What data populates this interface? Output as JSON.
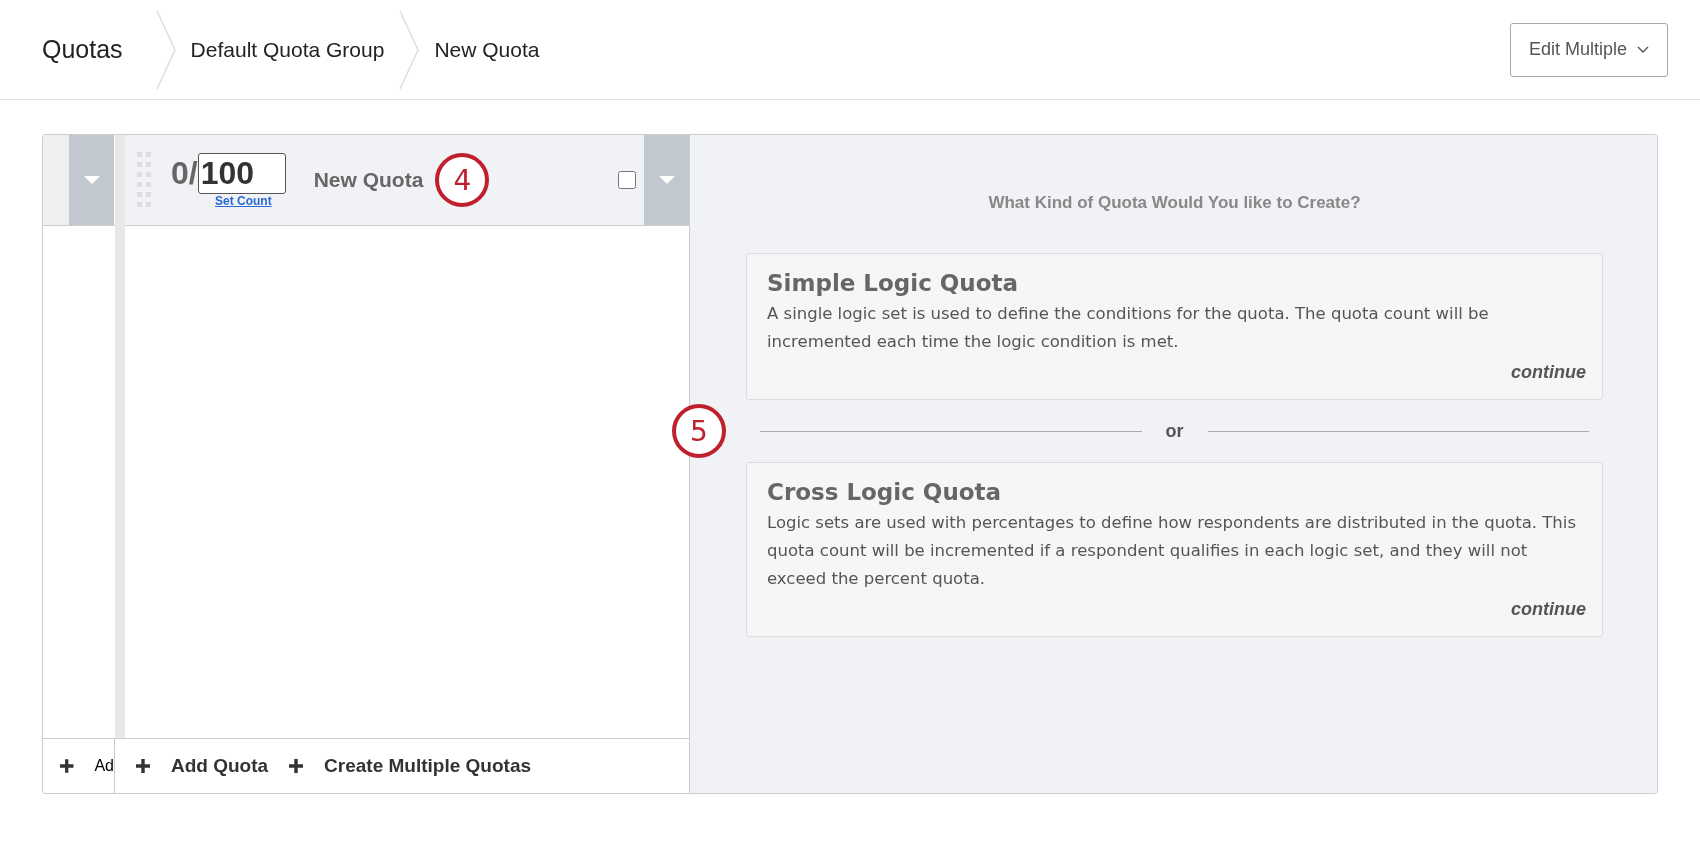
{
  "breadcrumbs": [
    {
      "label": "Quotas"
    },
    {
      "label": "Default Quota Group"
    },
    {
      "label": "New Quota"
    }
  ],
  "edit_multiple_button": {
    "label": "Edit Multiple"
  },
  "group_column": {
    "add_button": "Ad"
  },
  "quota": {
    "current": "0/",
    "limit": "100",
    "set_count_link": "Set Count",
    "name": "New Quota",
    "checked": false
  },
  "quota_toolbar": [
    {
      "label": "Add Quota"
    },
    {
      "label": "Create Multiple Quotas"
    }
  ],
  "picker": {
    "heading": "What Kind of Quota Would You like to Create?",
    "separator": "or",
    "options": [
      {
        "title": "Simple Logic Quota",
        "description": "A single logic set is used to define the conditions for the quota. The quota count will be incremented each time the logic condition is met.",
        "action": "continue"
      },
      {
        "title": "Cross Logic Quota",
        "description": "Logic sets are used with percentages to define how respondents are distributed in the quota. This quota count will be incremented if a respondent qualifies in each logic set, and they will not exceed the percent quota.",
        "action": "continue"
      }
    ]
  },
  "callouts": [
    {
      "number": "4"
    },
    {
      "number": "5"
    }
  ]
}
